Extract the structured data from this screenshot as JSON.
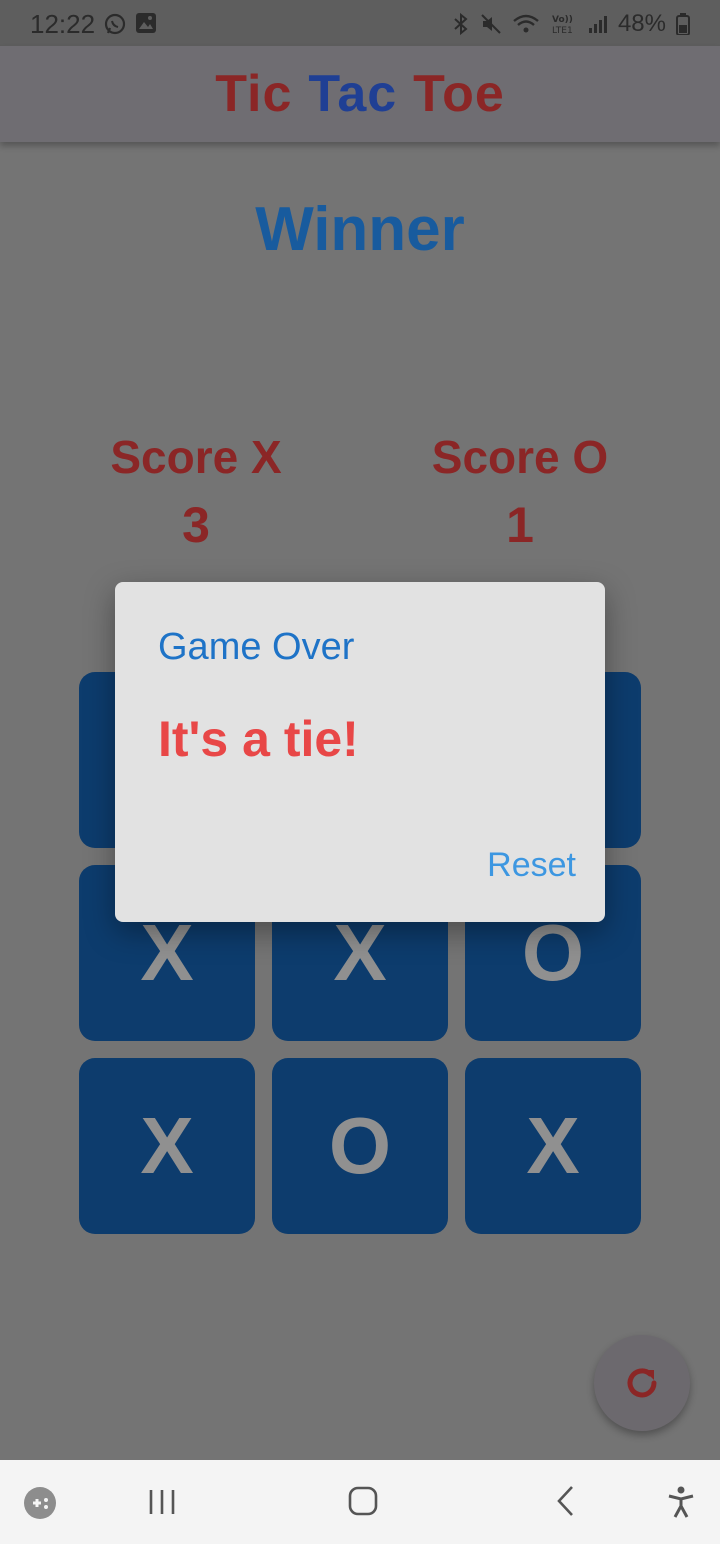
{
  "status_bar": {
    "time": "12:22",
    "battery_percent": "48%",
    "icons": [
      "whatsapp-icon",
      "gallery-icon",
      "bluetooth-icon",
      "mute-icon",
      "wifi-icon",
      "volte-icon",
      "signal-icon",
      "battery-icon"
    ]
  },
  "app_bar": {
    "title_words": [
      "Tic",
      "Tac",
      "Toe"
    ],
    "colors": {
      "tic": "#8b2626",
      "tac": "#1f3f94",
      "toe": "#8b2626"
    }
  },
  "game": {
    "status_text": "Winner",
    "score_x": {
      "label": "Score X",
      "value": "3"
    },
    "score_o": {
      "label": "Score O",
      "value": "1"
    },
    "board": [
      "",
      "",
      "",
      "X",
      "X",
      "O",
      "X",
      "O",
      "X"
    ]
  },
  "dialog": {
    "title": "Game Over",
    "message": "It's a tie!",
    "reset_label": "Reset"
  },
  "fab": {
    "icon": "refresh-icon"
  },
  "nav_bar": {
    "icons": [
      "game-launcher-icon",
      "recent-apps-icon",
      "home-icon",
      "back-icon",
      "accessibility-icon"
    ]
  }
}
